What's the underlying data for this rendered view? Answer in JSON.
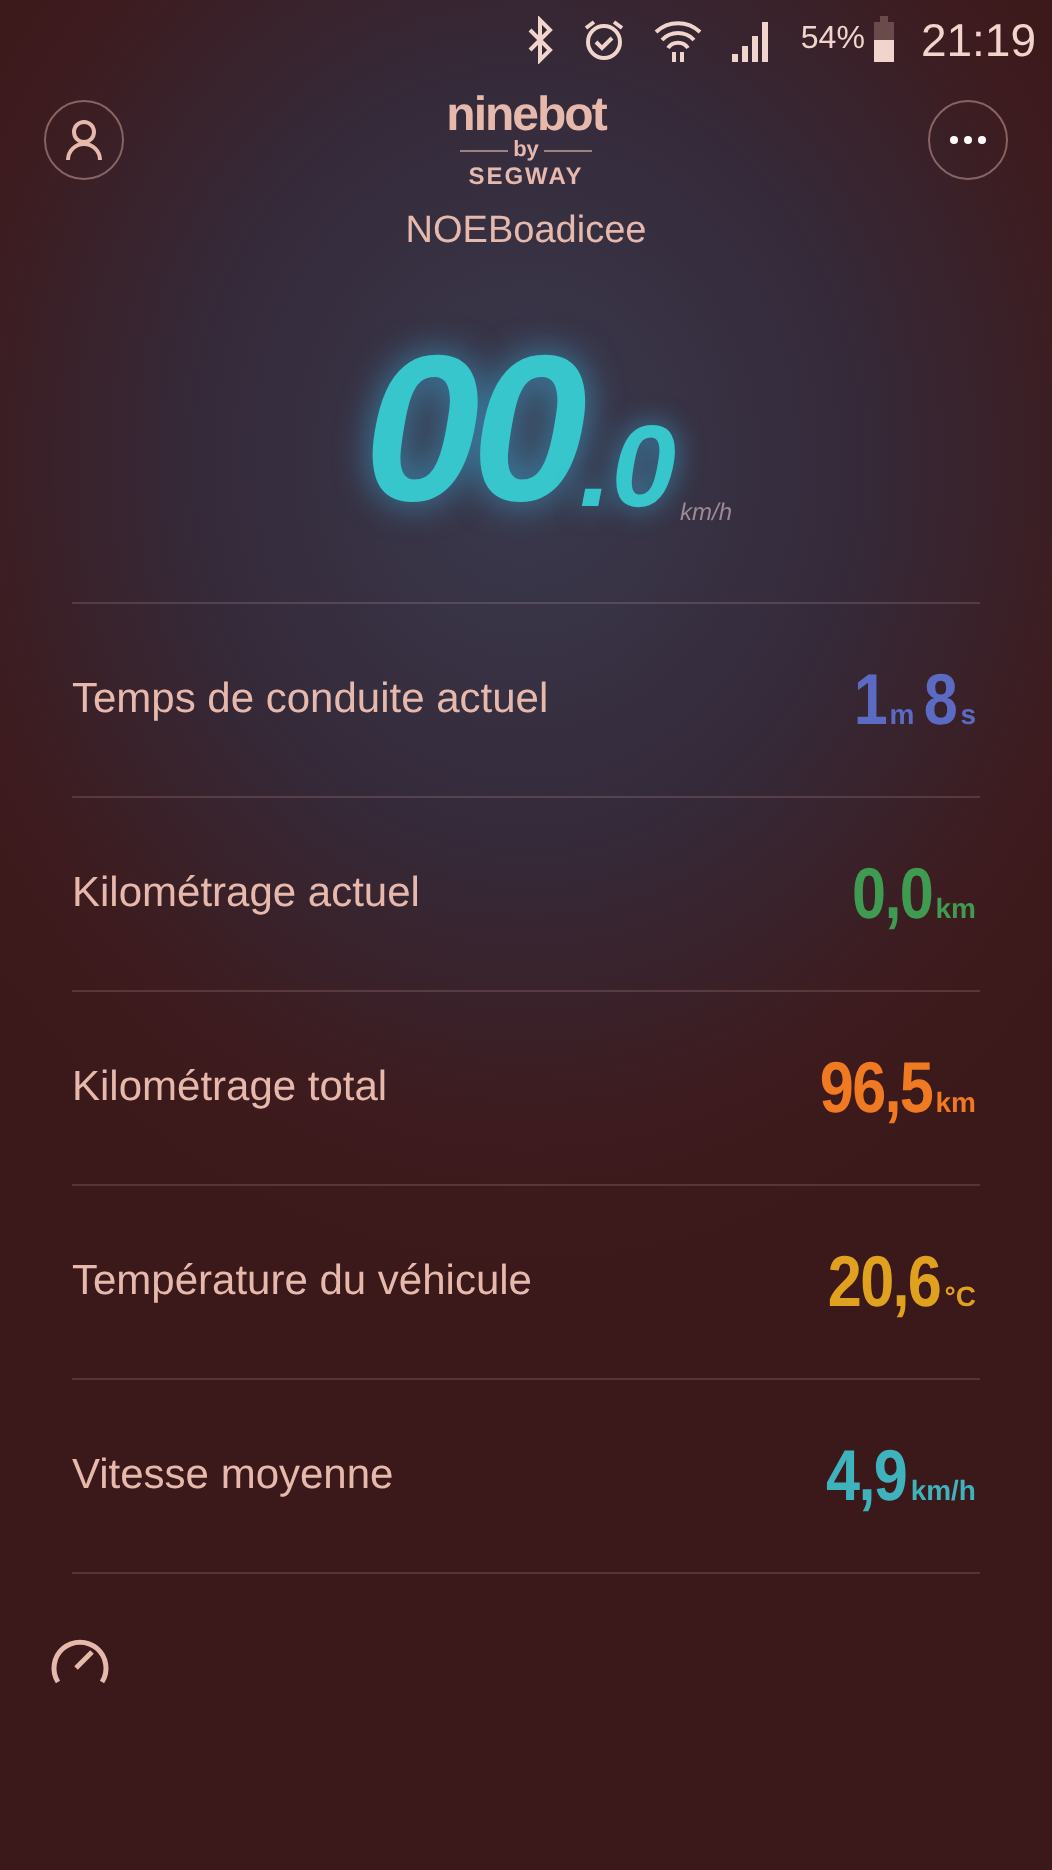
{
  "status_bar": {
    "battery": "54%",
    "time": "21:19"
  },
  "header": {
    "logo": {
      "brand": "ninebot",
      "by": "by",
      "maker": "SEGWAY"
    },
    "device_name": "NOEBoadicee"
  },
  "speed": {
    "whole": "00",
    "fraction": ".0",
    "unit": "km/h"
  },
  "stats": [
    {
      "label": "Temps de conduite actuel",
      "color": "#5b6bc4",
      "parts": [
        {
          "text": "1",
          "kind": "num"
        },
        {
          "text": "m",
          "kind": "unit"
        },
        {
          "text": "8",
          "kind": "num"
        },
        {
          "text": "s",
          "kind": "unit"
        }
      ]
    },
    {
      "label": "Kilométrage actuel",
      "color": "#3f9a52",
      "parts": [
        {
          "text": "0,0",
          "kind": "num"
        },
        {
          "text": "km",
          "kind": "unit"
        }
      ]
    },
    {
      "label": "Kilométrage total",
      "color": "#f07a22",
      "parts": [
        {
          "text": "96,5",
          "kind": "num"
        },
        {
          "text": "km",
          "kind": "unit"
        }
      ]
    },
    {
      "label": "Température du véhicule",
      "color": "#e0a21e",
      "parts": [
        {
          "text": "20,6",
          "kind": "num"
        },
        {
          "text": "°C",
          "kind": "unit"
        }
      ]
    },
    {
      "label": "Vitesse moyenne",
      "color": "#3fb3bd",
      "parts": [
        {
          "text": "4,9",
          "kind": "num"
        },
        {
          "text": "km/h",
          "kind": "unit"
        }
      ]
    }
  ]
}
